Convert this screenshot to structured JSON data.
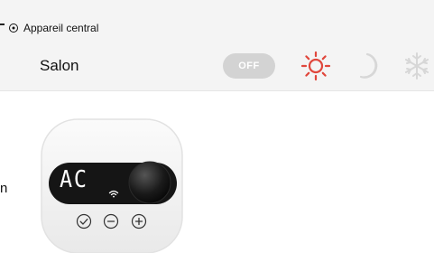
{
  "header": {
    "central_device_label": "Appareil central",
    "room_name": "Salon",
    "off_button_label": "OFF"
  },
  "device": {
    "display_text": "AC",
    "left_label_fragment": "n"
  },
  "icons": {
    "central": "target-icon",
    "modes": [
      "sun-icon",
      "moon-icon",
      "snowflake-icon"
    ],
    "buttons": [
      "check-icon",
      "minus-icon",
      "plus-icon"
    ],
    "wifi": "wifi-icon"
  },
  "colors": {
    "sun_active": "#e0473c",
    "inactive_icon": "#d7d7d7",
    "off_button": "#d3d3d3",
    "panel_background": "#f4f4f4"
  }
}
